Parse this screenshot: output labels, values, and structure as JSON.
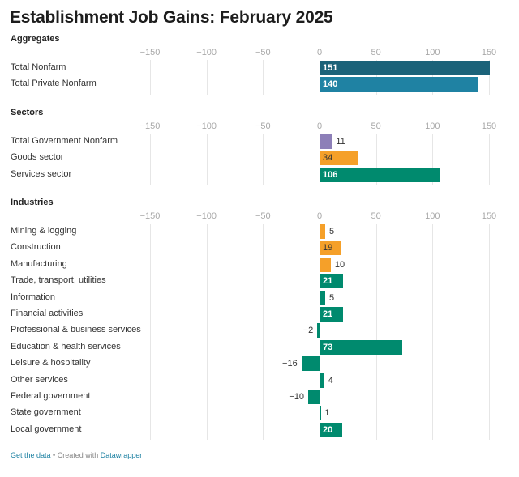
{
  "chart_data": {
    "type": "bar",
    "orientation": "horizontal",
    "title": "Establishment Job Gains: February 2025",
    "xlim": [
      -150,
      150
    ],
    "ticks": [
      -150,
      -100,
      -50,
      0,
      50,
      100,
      150
    ],
    "tick_labels": [
      "−150",
      "−100",
      "−50",
      "0",
      "50",
      "100",
      "150"
    ],
    "grid": true,
    "panels": [
      {
        "name": "Aggregates",
        "categories": [
          "Total Nonfarm",
          "Total Private Nonfarm"
        ],
        "values": [
          151,
          140
        ],
        "colors": [
          "#1b6279",
          "#1f82a3"
        ]
      },
      {
        "name": "Sectors",
        "categories": [
          "Total Government Nonfarm",
          "Goods sector",
          "Services sector"
        ],
        "values": [
          11,
          34,
          106
        ],
        "colors": [
          "#8d7fb8",
          "#f5a029",
          "#008a6e"
        ]
      },
      {
        "name": "Industries",
        "categories": [
          "Mining & logging",
          "Construction",
          "Manufacturing",
          "Trade, transport, utilities",
          "Information",
          "Financial activities",
          "Professional & business services",
          "Education & health services",
          "Leisure & hospitality",
          "Other services",
          "Federal government",
          "State government",
          "Local government"
        ],
        "values": [
          5,
          19,
          10,
          21,
          5,
          21,
          -2,
          73,
          -16,
          4,
          -10,
          1,
          20
        ],
        "value_labels": [
          "5",
          "19",
          "10",
          "21",
          "5",
          "21",
          "−2",
          "73",
          "−16",
          "4",
          "−10",
          "1",
          "20"
        ],
        "colors": [
          "#f5a029",
          "#f5a029",
          "#f5a029",
          "#008a6e",
          "#008a6e",
          "#008a6e",
          "#008a6e",
          "#008a6e",
          "#008a6e",
          "#008a6e",
          "#008a6e",
          "#008a6e",
          "#008a6e"
        ]
      }
    ]
  },
  "footer": {
    "data_link": "Get the data",
    "separator": " • Created with ",
    "credit_link": "Datawrapper"
  }
}
